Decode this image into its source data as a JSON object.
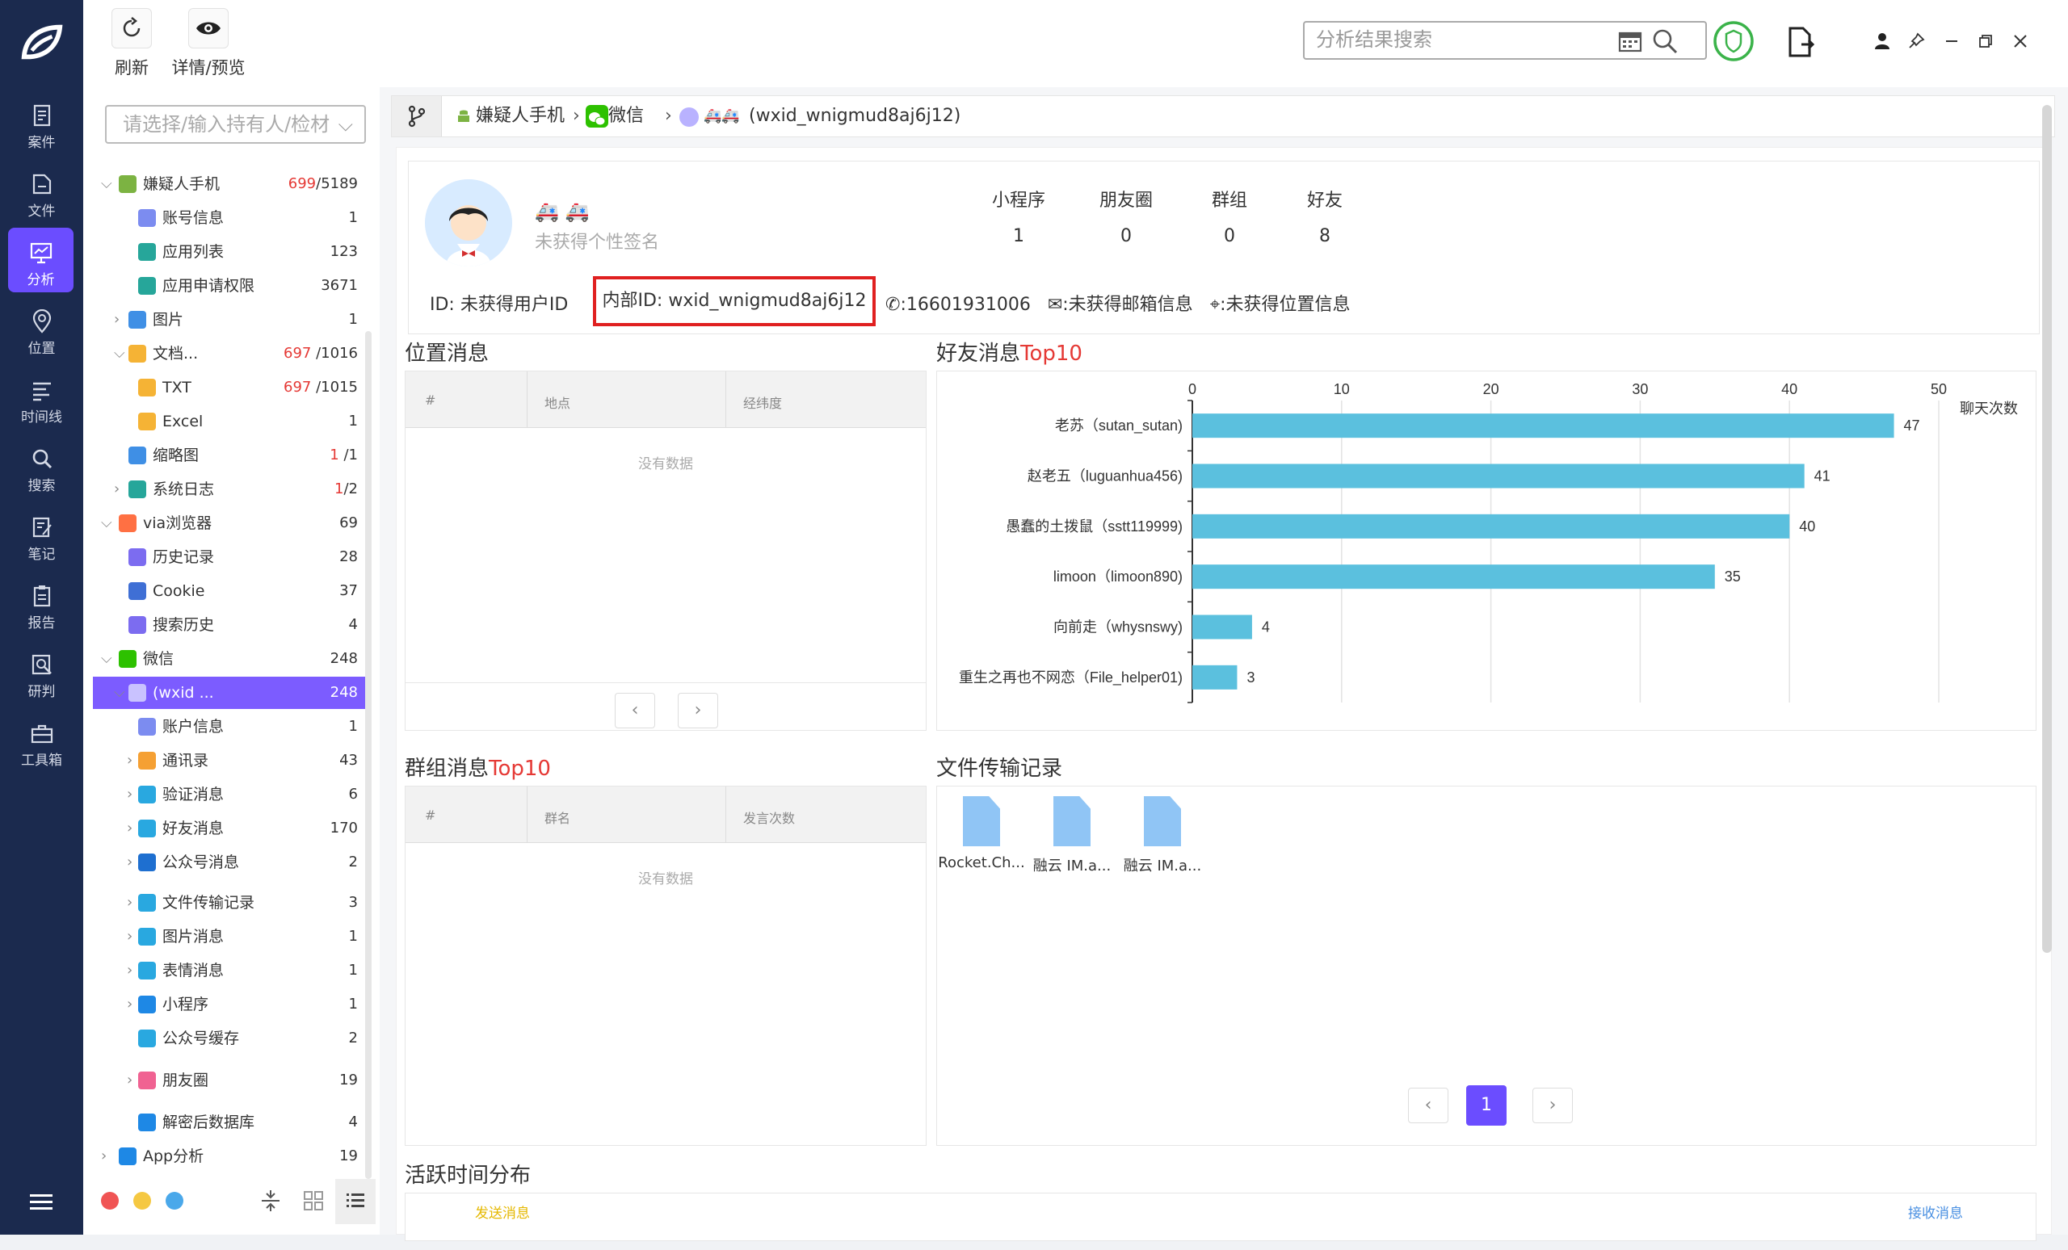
{
  "toolbar": {
    "refresh_label": "刷新",
    "detail_label": "详情/预览",
    "search_placeholder": "分析结果搜索"
  },
  "rail": {
    "items": [
      {
        "label": "案件",
        "icon": "case-icon"
      },
      {
        "label": "文件",
        "icon": "file-icon"
      },
      {
        "label": "分析",
        "icon": "analysis-icon",
        "active": true
      },
      {
        "label": "位置",
        "icon": "location-icon"
      },
      {
        "label": "时间线",
        "icon": "timeline-icon"
      },
      {
        "label": "搜索",
        "icon": "search-icon"
      },
      {
        "label": "笔记",
        "icon": "note-icon"
      },
      {
        "label": "报告",
        "icon": "report-icon"
      },
      {
        "label": "研判",
        "icon": "judge-icon"
      },
      {
        "label": "工具箱",
        "icon": "toolbox-icon"
      }
    ]
  },
  "left": {
    "holder_placeholder": "请选择/输入持有人/检材",
    "tree": [
      {
        "label": "嫌疑人手机",
        "hl": "699",
        "rest": "/5189",
        "icon": "android-icon",
        "color": "#7cb342",
        "level": 0,
        "arrow": "down"
      },
      {
        "label": "账号信息",
        "hl": "",
        "rest": "1",
        "icon": "account-icon",
        "color": "#7c8cf0",
        "level": 2
      },
      {
        "label": "应用列表",
        "hl": "",
        "rest": "123",
        "icon": "app-list-icon",
        "color": "#26a69a",
        "level": 2
      },
      {
        "label": "应用申请权限",
        "hl": "",
        "rest": "3671",
        "icon": "permission-icon",
        "color": "#26a69a",
        "level": 2
      },
      {
        "label": "图片",
        "hl": "",
        "rest": "1",
        "icon": "image-icon",
        "color": "#3f8fe5",
        "level": 1,
        "arrow": "right"
      },
      {
        "label": "文档...",
        "hl": "697",
        "rest": " /1016",
        "icon": "document-icon",
        "color": "#f5b335",
        "level": 1,
        "arrow": "down"
      },
      {
        "label": "TXT",
        "hl": "697",
        "rest": " /1015",
        "icon": "txt-icon",
        "color": "#f5b335",
        "level": 2
      },
      {
        "label": "Excel",
        "hl": "",
        "rest": "1",
        "icon": "excel-icon",
        "color": "#f5b335",
        "level": 2
      },
      {
        "label": "缩略图",
        "hl": "1",
        "rest": " /1",
        "icon": "thumbnail-icon",
        "color": "#3f8fe5",
        "level": 1
      },
      {
        "label": "系统日志",
        "hl": "1",
        "rest": "/2",
        "icon": "syslog-icon",
        "color": "#26a69a",
        "level": 1,
        "arrow": "right"
      },
      {
        "label": "via浏览器",
        "hl": "",
        "rest": "69",
        "icon": "via-browser-icon",
        "color": "#ff7043",
        "level": 0,
        "arrow": "down"
      },
      {
        "label": "历史记录",
        "hl": "",
        "rest": "28",
        "icon": "history-icon",
        "color": "#7c6cf0",
        "level": 1
      },
      {
        "label": "Cookie",
        "hl": "",
        "rest": "37",
        "icon": "cookie-icon",
        "color": "#3f6fd5",
        "level": 1
      },
      {
        "label": "搜索历史",
        "hl": "",
        "rest": "4",
        "icon": "search-history-icon",
        "color": "#7c6cf0",
        "level": 1
      },
      {
        "label": "微信",
        "hl": "",
        "rest": "248",
        "icon": "wechat-icon",
        "color": "#2dc100",
        "level": 0,
        "arrow": "down"
      },
      {
        "label": "(wxid ...",
        "hl": "",
        "rest": "248",
        "icon": "user-avatar-icon",
        "color": "#c9c2ff",
        "level": 1,
        "arrow": "down",
        "selected": true
      },
      {
        "label": "账户信息",
        "hl": "",
        "rest": "1",
        "icon": "account-info-icon",
        "color": "#7c8cf0",
        "level": 2
      },
      {
        "label": "通讯录",
        "hl": "",
        "rest": "43",
        "icon": "contacts-icon",
        "color": "#f5a033",
        "level": 2,
        "arrow": "right"
      },
      {
        "label": "验证消息",
        "hl": "",
        "rest": "6",
        "icon": "verify-msg-icon",
        "color": "#29a8e0",
        "level": 2,
        "arrow": "right"
      },
      {
        "label": "好友消息",
        "hl": "",
        "rest": "170",
        "icon": "friend-msg-icon",
        "color": "#29a8e0",
        "level": 2,
        "arrow": "right"
      },
      {
        "label": "公众号消息",
        "hl": "",
        "rest": "2",
        "icon": "official-msg-icon",
        "color": "#1e6fd0",
        "level": 2,
        "arrow": "right"
      },
      {
        "label": "文件传输记录",
        "hl": "",
        "rest": "3",
        "icon": "file-transfer-icon",
        "color": "#29a8e0",
        "level": 2,
        "arrow": "right"
      },
      {
        "label": "图片消息",
        "hl": "",
        "rest": "1",
        "icon": "image-msg-icon",
        "color": "#29a8e0",
        "level": 2,
        "arrow": "right"
      },
      {
        "label": "表情消息",
        "hl": "",
        "rest": "1",
        "icon": "emoji-msg-icon",
        "color": "#29a8e0",
        "level": 2,
        "arrow": "right"
      },
      {
        "label": "小程序",
        "hl": "",
        "rest": "1",
        "icon": "mini-program-icon",
        "color": "#1e88e5",
        "level": 2,
        "arrow": "right"
      },
      {
        "label": "公众号缓存",
        "hl": "",
        "rest": "2",
        "icon": "official-cache-icon",
        "color": "#29a8e0",
        "level": 2
      },
      {
        "label": "朋友圈",
        "hl": "",
        "rest": "19",
        "icon": "moments-icon",
        "color": "#f06292",
        "level": 2,
        "arrow": "right"
      },
      {
        "label": "解密后数据库",
        "hl": "",
        "rest": "4",
        "icon": "database-icon",
        "color": "#1e88e5",
        "level": 2
      },
      {
        "label": "App分析",
        "hl": "",
        "rest": "19",
        "icon": "app-analysis-icon",
        "color": "#1e88e5",
        "level": 0,
        "arrow": "right"
      }
    ]
  },
  "breadcrumb": {
    "phone": "嫌疑人手机",
    "wechat": "微信",
    "user": "(wxid_wnigmud8aj6j12)"
  },
  "profile": {
    "signature": "未获得个性签名",
    "stats": [
      {
        "label": "小程序",
        "value": "1"
      },
      {
        "label": "朋友圈",
        "value": "0"
      },
      {
        "label": "群组",
        "value": "0"
      },
      {
        "label": "好友",
        "value": "8"
      }
    ],
    "user_id": "ID: 未获得用户ID",
    "inner_id": "内部ID: wxid_wnigmud8aj6j12",
    "phone": ":16601931006",
    "email": ":未获得邮箱信息",
    "location": ":未获得位置信息"
  },
  "location_panel": {
    "title": "位置消息",
    "columns": [
      "#",
      "地点",
      "经纬度"
    ],
    "empty": "没有数据"
  },
  "group_panel": {
    "title": "群组消息",
    "title_hl": "Top10",
    "columns": [
      "#",
      "群名",
      "发言次数"
    ],
    "empty": "没有数据"
  },
  "friend_panel": {
    "title": "好友消息",
    "title_hl": "Top10"
  },
  "chart_data": {
    "type": "bar",
    "orientation": "horizontal",
    "categories": [
      "老苏（sutan_sutan)",
      "赵老五（luguanhua456)",
      "愚蠢的土拨鼠（sstt119999)",
      "limoon（limoon890)",
      "向前走（whysnswy)",
      "重生之再也不网恋（File_helper01)"
    ],
    "values": [
      47,
      41,
      40,
      35,
      4,
      3
    ],
    "xlim": [
      0,
      50
    ],
    "ticks": [
      0,
      10,
      20,
      30,
      40,
      50
    ],
    "axis_label": "聊天次数",
    "color": "#5bc0de",
    "grid": true
  },
  "file_panel": {
    "title": "文件传输记录",
    "files": [
      "Rocket.Ch...",
      "融云 IM.a...",
      "融云 IM.a..."
    ],
    "page": "1"
  },
  "active_panel": {
    "title": "活跃时间分布",
    "legend_left": "发送消息",
    "legend_right": "接收消息"
  }
}
